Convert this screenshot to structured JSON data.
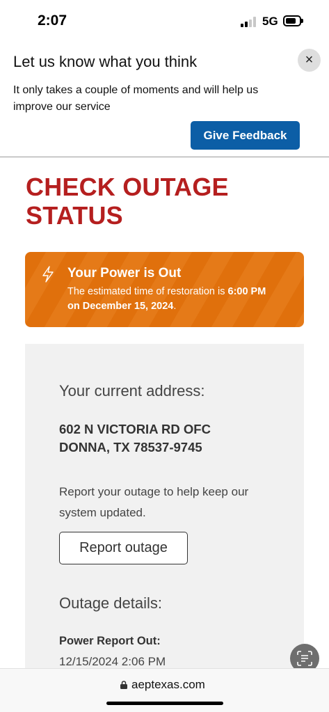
{
  "status_bar": {
    "time": "2:07",
    "network": "5G"
  },
  "feedback": {
    "title": "Let us know what you think",
    "text": "It only takes a couple of moments and will help us improve our service",
    "button_label": "Give Feedback",
    "close_label": "×",
    "button_color": "#0c5ea6"
  },
  "page": {
    "heading_line1": "CHECK OUTAGE",
    "heading_line2": "STATUS",
    "heading_color": "#b51f1f"
  },
  "alert": {
    "title": "Your Power is Out",
    "text_prefix": "The estimated time of restoration is ",
    "time": "6:00 PM",
    "date": "on December 15, 2024",
    "text_suffix": ".",
    "color": "#e0700c",
    "icon": "lightning-bolt-icon"
  },
  "address": {
    "label": "Your current address:",
    "line1": "602 N VICTORIA RD OFC",
    "line2": "DONNA, TX 78537-9745"
  },
  "report": {
    "text": "Report your outage to help keep our system updated.",
    "button_label": "Report outage"
  },
  "details": {
    "label": "Outage details:",
    "power_report_label": "Power Report Out:",
    "power_report_value": "12/15/2024 2:06 PM"
  },
  "browser": {
    "url": "aeptexas.com"
  }
}
